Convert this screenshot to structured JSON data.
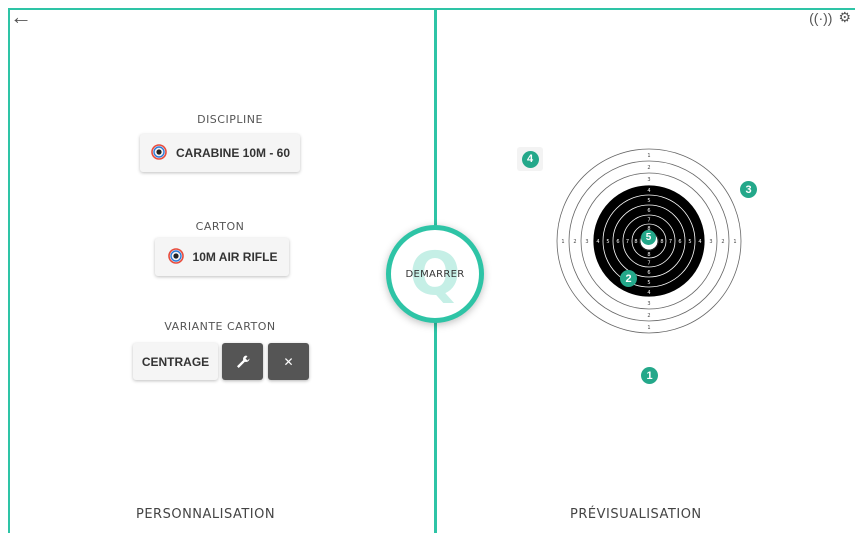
{
  "nav": {
    "back_glyph": "←"
  },
  "left": {
    "discipline": {
      "heading": "DISCIPLINE",
      "value": "CARABINE 10M - 60",
      "icon": "issf-logo-icon"
    },
    "carton": {
      "heading": "CARTON",
      "value": "10M AIR RIFLE",
      "icon": "issf-logo-icon"
    },
    "variante": {
      "heading": "VARIANTE CARTON",
      "value": "CENTRAGE",
      "edit_icon": "wrench-icon",
      "remove_glyph": "✕"
    },
    "footer": "PERSONNALISATION"
  },
  "center": {
    "start_label": "DEMARRER"
  },
  "right": {
    "footer": "PRÉVISUALISATION",
    "markers": [
      "1",
      "2",
      "3",
      "4",
      "5"
    ],
    "target_outer_rings": [
      "1",
      "2",
      "3"
    ],
    "target_inner_rings": [
      "4",
      "5",
      "6",
      "7",
      "8",
      "9"
    ]
  },
  "status": {
    "signal_icon": "wireless-icon",
    "settings_icon": "gear-icon"
  },
  "colors": {
    "accent": "#2ec4a6",
    "badge": "#24a88a",
    "dark_button": "#555555"
  }
}
